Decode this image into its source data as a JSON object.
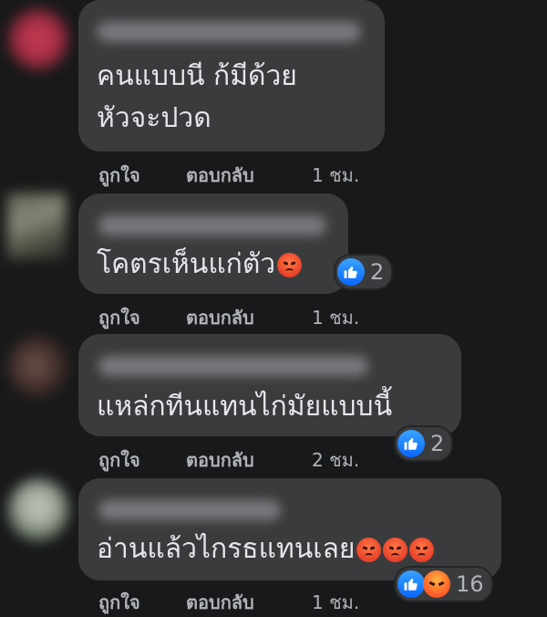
{
  "comments": [
    {
      "text_line1": "คนแบบนี ก้มีด้วย",
      "text_line2": "หัวจะปวด",
      "like": "ถูกใจ",
      "reply": "ตอบกลับ",
      "time": "1 ชม."
    },
    {
      "text": "โคตรเห็นแก่ตัว",
      "like": "ถูกใจ",
      "reply": "ตอบกลับ",
      "time": "1 ชม.",
      "reaction_count": "2",
      "reaction_icons": [
        "like-icon"
      ]
    },
    {
      "text": "แหล่กทีนแทนไก่มัยแบบนี้",
      "like": "ถูกใจ",
      "reply": "ตอบกลับ",
      "time": "2 ชม.",
      "reaction_count": "2",
      "reaction_icons": [
        "like-icon"
      ]
    },
    {
      "text": "อ่านแล้วไกรธแทนเลย",
      "like": "ถูกใจ",
      "reply": "ตอบกลับ",
      "time": "1 ชม.",
      "reaction_count": "16",
      "reaction_icons": [
        "like-icon",
        "angry-icon"
      ]
    }
  ],
  "colors": {
    "background": "#18191a",
    "bubble": "#3a3b3c",
    "text": "#e4e6eb",
    "secondary_text": "#b0b3b8",
    "like_blue": "#0866ff",
    "angry_orange": "#e8402a"
  }
}
